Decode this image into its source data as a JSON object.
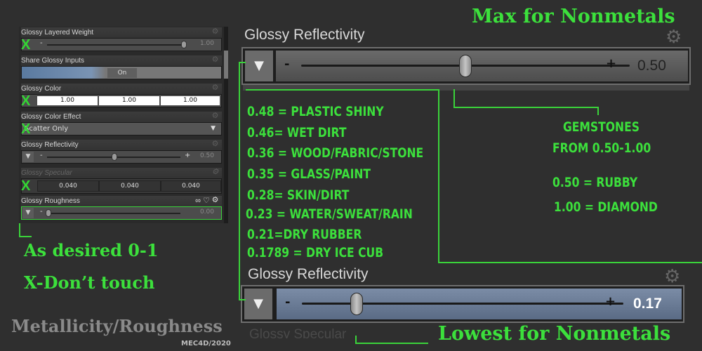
{
  "panel": {
    "glossy_layered_weight": {
      "label": "Glossy Layered Weight",
      "value": "1.00",
      "x_mark": "X"
    },
    "share_glossy_inputs": {
      "label": "Share Glossy Inputs",
      "toggle": "On"
    },
    "glossy_color": {
      "label": "Glossy Color",
      "values": [
        "1.00",
        "1.00",
        "1.00"
      ],
      "x_mark": "X"
    },
    "glossy_color_effect": {
      "label": "Glossy Color Effect",
      "selected": "Scatter Only",
      "x_mark": "X"
    },
    "glossy_reflectivity": {
      "label": "Glossy Reflectivity",
      "value": "0.50"
    },
    "glossy_specular": {
      "label": "Glossy Specular",
      "values": [
        "0.040",
        "0.040",
        "0.040"
      ],
      "x_mark": "X"
    },
    "glossy_roughness": {
      "label": "Glossy Roughness",
      "value": "0.00"
    }
  },
  "big_slider_top": {
    "title": "Glossy Reflectivity",
    "value": "0.50",
    "level": 0.5
  },
  "big_slider_bottom": {
    "title": "Glossy Reflectivity",
    "value": "0.17",
    "level": 0.17,
    "next_label": "Glossy Specular"
  },
  "annotations": {
    "max_label": "Max for Nonmetals",
    "lowest_label": "Lowest for Nonmetals",
    "as_desired": "As desired 0-1",
    "dont_touch": "X-Don’t touch",
    "title": "Metallicity/Roughness",
    "credit": "MEC4D/2020",
    "presets": [
      "0.48 = PLASTIC SHINY",
      "0.46= WET DIRT",
      "0.36 = WOOD/FABRIC/STONE",
      "0.35 = GLASS/PAINT",
      "0.28= SKIN/DIRT",
      "0.23 = WATER/SWEAT/RAIN",
      "0.21=DRY RUBBER",
      "0.1789 = DRY ICE CUB"
    ],
    "gemstones_line1": "GEMSTONES",
    "gemstones_line2": "FROM 0.50-1.00",
    "ruby": "0.50 = RUBBY",
    "diamond": "1.00 = DIAMOND"
  },
  "colors": {
    "annotation_green": "#3ce03c",
    "panel_bg": "#2a2a2a",
    "slider_gradient_top": "#6a6a6a"
  },
  "icons": [
    "gear-icon",
    "dropdown-triangle-icon",
    "minus-icon",
    "plus-icon",
    "link-icon",
    "heart-icon"
  ]
}
